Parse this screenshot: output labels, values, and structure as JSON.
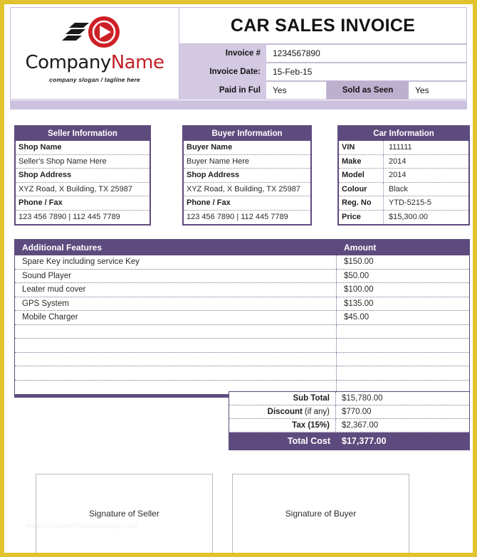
{
  "document": {
    "title": "CAR SALES INVOICE",
    "accent_purple": "#5E4B7E",
    "accent_lavender": "#D3C9E2",
    "accent_lavender_dark": "#BDB0CF",
    "border_yellow": "#E0C32E"
  },
  "logo": {
    "name_part1": "Company",
    "name_part2": "Name",
    "tagline": "company slogan / tagline here",
    "mark": "red-circle-play-arrow"
  },
  "invoice_meta": {
    "invoice_number_label": "Invoice #",
    "invoice_number_value": "1234567890",
    "invoice_date_label": "Invoice Date:",
    "invoice_date_value": "15-Feb-15",
    "paid_in_full_label": "Paid in Ful",
    "paid_in_full_value": "Yes",
    "sold_as_seen_label": "Sold as Seen",
    "sold_as_seen_value": "Yes"
  },
  "seller": {
    "heading": "Seller Information",
    "rows": [
      {
        "label": "Shop Name",
        "value": "Seller's Shop Name Here"
      },
      {
        "label": "Shop Address",
        "value": "XYZ Road, X Building, TX 25987"
      },
      {
        "label": "Phone / Fax",
        "value": "123 456 7890 | 112 445 7789"
      }
    ]
  },
  "buyer": {
    "heading": "Buyer Information",
    "rows": [
      {
        "label": "Buyer Name",
        "value": "Buyer Name Here"
      },
      {
        "label": "Shop Address",
        "value": "XYZ Road, X Building, TX 25987"
      },
      {
        "label": "Phone / Fax",
        "value": "123 456 7890 | 112 445 7789"
      }
    ]
  },
  "car": {
    "heading": "Car Information",
    "rows": [
      {
        "key": "VIN",
        "value": "111111"
      },
      {
        "key": "Make",
        "value": "2014"
      },
      {
        "key": "Model",
        "value": "2014"
      },
      {
        "key": "Colour",
        "value": "Black"
      },
      {
        "key": "Reg. No",
        "value": "YTD-5215-5"
      },
      {
        "key": "Price",
        "value": "$15,300.00"
      }
    ]
  },
  "features": {
    "col_description": "Additional Features",
    "col_amount": "Amount",
    "rows": [
      {
        "description": "Spare Key including service Key",
        "amount": "$150.00"
      },
      {
        "description": "Sound Player",
        "amount": "$50.00"
      },
      {
        "description": "Leater mud cover",
        "amount": "$100.00"
      },
      {
        "description": "GPS System",
        "amount": "$135.00"
      },
      {
        "description": "Mobile Charger",
        "amount": "$45.00"
      },
      {
        "description": "",
        "amount": ""
      },
      {
        "description": "",
        "amount": ""
      },
      {
        "description": "",
        "amount": ""
      },
      {
        "description": "",
        "amount": ""
      },
      {
        "description": "",
        "amount": ""
      }
    ]
  },
  "totals": {
    "sub_total_label": "Sub Total",
    "sub_total_value": "$15,780.00",
    "discount_label": "Discount",
    "discount_label_soft": "(if any)",
    "discount_value": "$770.00",
    "tax_label": "Tax (15%)",
    "tax_value": "$2,367.00",
    "total_label": "Total Cost",
    "total_value": "$17,377.00"
  },
  "signatures": {
    "seller": "Signature of Seller",
    "buyer": "Signature of Buyer"
  },
  "watermark": "www.heritagechristiancollege.com"
}
